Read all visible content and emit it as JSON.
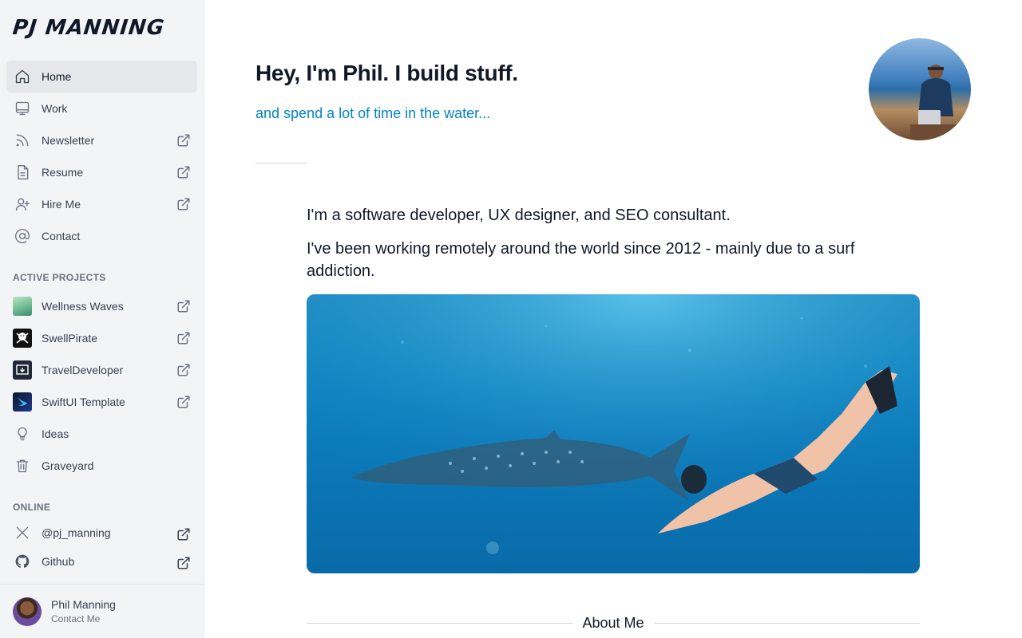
{
  "sidebar": {
    "logo": "PJ MANNING",
    "nav": [
      {
        "label": "Home",
        "icon": "home-icon",
        "external": false,
        "active": true
      },
      {
        "label": "Work",
        "icon": "desktop-icon",
        "external": false
      },
      {
        "label": "Newsletter",
        "icon": "rss-icon",
        "external": true
      },
      {
        "label": "Resume",
        "icon": "document-icon",
        "external": true
      },
      {
        "label": "Hire Me",
        "icon": "user-plus-icon",
        "external": true
      },
      {
        "label": "Contact",
        "icon": "at-sign-icon",
        "external": false
      }
    ],
    "active_projects_label": "ACTIVE PROJECTS",
    "projects": [
      {
        "label": "Wellness Waves",
        "external": true
      },
      {
        "label": "SwellPirate",
        "external": true
      },
      {
        "label": "TravelDeveloper",
        "external": true
      },
      {
        "label": "SwiftUI Template",
        "external": true
      },
      {
        "label": "Ideas",
        "icon": "lightbulb-icon",
        "external": false
      },
      {
        "label": "Graveyard",
        "icon": "trash-icon",
        "external": false
      }
    ],
    "online_label": "ONLINE",
    "online": [
      {
        "label": "@pj_manning",
        "icon": "x-logo-icon",
        "external": true
      },
      {
        "label": "Github",
        "icon": "github-icon",
        "external": true
      }
    ],
    "user": {
      "name": "Phil Manning",
      "subtitle": "Contact Me"
    }
  },
  "main": {
    "title": "Hey, I'm Phil. I build stuff.",
    "subtitle": "and spend a lot of time in the water...",
    "paragraph1": "I'm a software developer, UX designer, and SEO consultant.",
    "paragraph2": "I've been working remotely around the world since 2012 - mainly due to a surf addiction.",
    "section_heading": "About Me"
  },
  "colors": {
    "accent": "#0284c7",
    "sidebar_bg": "#f3f4f6",
    "active_bg": "#e5e7eb"
  }
}
